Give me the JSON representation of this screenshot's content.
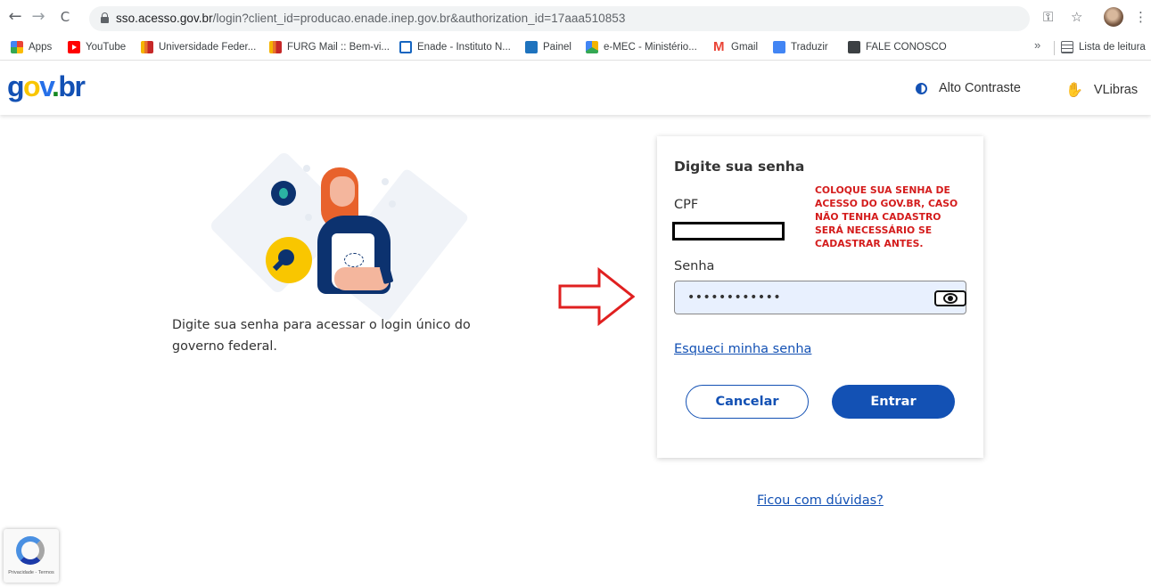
{
  "browser": {
    "url_host": "sso.acesso.gov.br",
    "url_path": "/login?client_id=producao.enade.inep.gov.br&authorization_id=17aaa510853",
    "nav": {
      "back": "←",
      "forward": "→",
      "reload": "C"
    },
    "icons": {
      "key": "key-icon",
      "star": "star-icon",
      "menu": "kebab-menu-icon"
    }
  },
  "bookmarks": {
    "items": [
      {
        "label": "Apps",
        "icon": "apps-grid-icon"
      },
      {
        "label": "YouTube",
        "icon": "youtube-icon"
      },
      {
        "label": "Universidade Feder...",
        "icon": "furg-icon"
      },
      {
        "label": "FURG Mail :: Bem-vi...",
        "icon": "furg-icon"
      },
      {
        "label": "Enade - Instituto N...",
        "icon": "enade-icon"
      },
      {
        "label": "Painel",
        "icon": "painel-icon"
      },
      {
        "label": "e-MEC - Ministério...",
        "icon": "emec-icon"
      },
      {
        "label": "Gmail",
        "icon": "gmail-icon"
      },
      {
        "label": "Traduzir",
        "icon": "translate-icon"
      },
      {
        "label": "FALE CONOSCO",
        "icon": "globe-icon"
      }
    ],
    "more": "»",
    "reading_list": "Lista de leitura"
  },
  "header": {
    "logo": {
      "g": "g",
      "o": "o",
      "v": "v",
      "dot": ".",
      "br": "br"
    },
    "contrast_label": "Alto Contraste",
    "vlibras_label": "VLibras",
    "vlibras_glyph": "✋"
  },
  "intro": {
    "text": "Digite sua senha para acessar o login único do governo federal."
  },
  "login": {
    "title": "Digite sua senha",
    "cpf_label": "CPF",
    "password_label": "Senha",
    "password_value": "••••••••••••",
    "forgot_link": "Esqueci minha senha",
    "cancel_button": "Cancelar",
    "enter_button": "Entrar",
    "annotation": "COLOQUE SUA SENHA DE ACESSO DO GOV.BR, CASO NÃO TENHA CADASTRO SERÁ NECESSÁRIO SE CADASTRAR ANTES."
  },
  "help_link": "Ficou com dúvidas?",
  "recaptcha": {
    "text": "Privacidade - Termos"
  },
  "colors": {
    "primary": "#1351b4",
    "annotation_red": "#d41c1c",
    "input_bg": "#e8f0fe"
  }
}
